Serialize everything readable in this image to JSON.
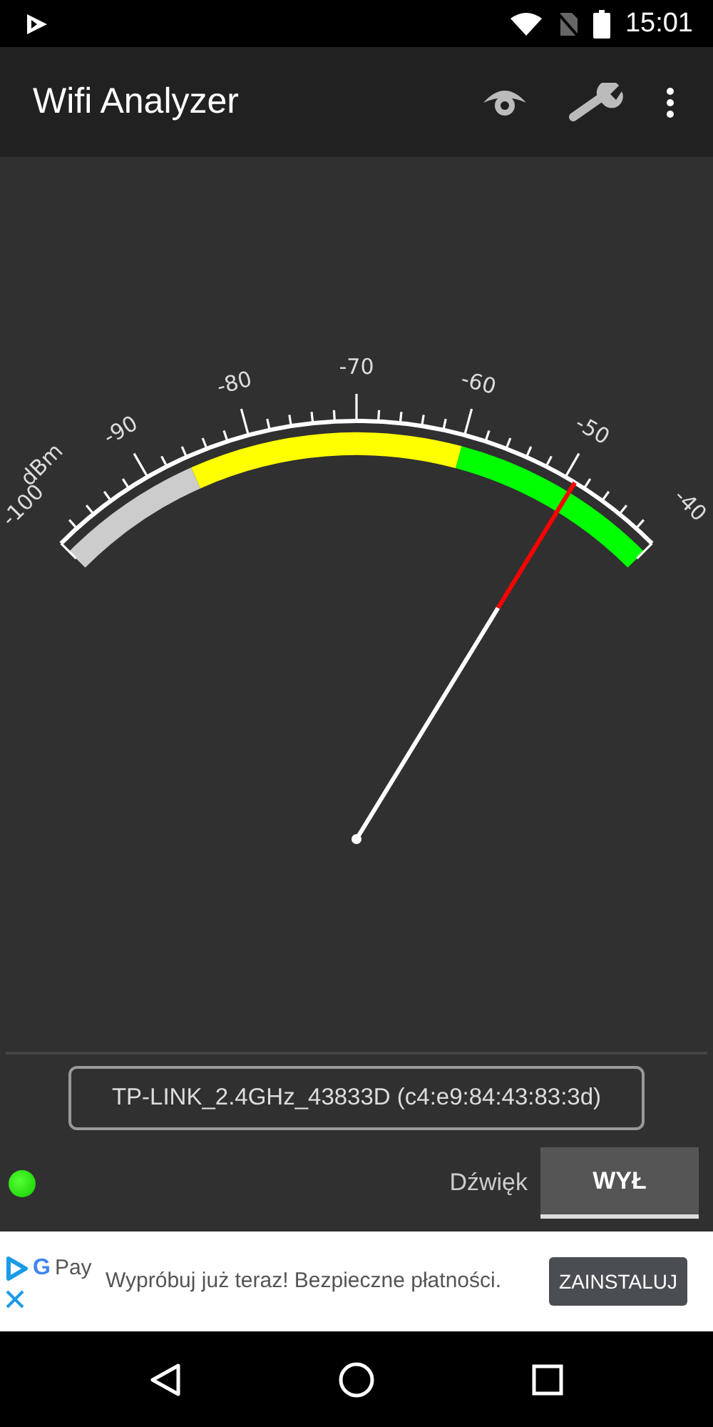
{
  "status_bar": {
    "time": "15:01"
  },
  "app_bar": {
    "title": "Wifi Analyzer"
  },
  "gauge": {
    "unit": "dBm",
    "labels": [
      "-100",
      "-90",
      "-80",
      "-70",
      "-60",
      "-50",
      "-40"
    ]
  },
  "network": {
    "text": "TP-LINK_2.4GHz_43833D (c4:e9:84:43:83:3d)"
  },
  "controls": {
    "indicator_on": true,
    "sound_label": "Dźwięk",
    "sound_button": "WYŁ"
  },
  "ad": {
    "brand_g": "G",
    "brand_pay": "Pay",
    "text": "Wypróbuj już teraz! Bezpieczne płatności.",
    "button": "ZAINSTALUJ"
  }
}
